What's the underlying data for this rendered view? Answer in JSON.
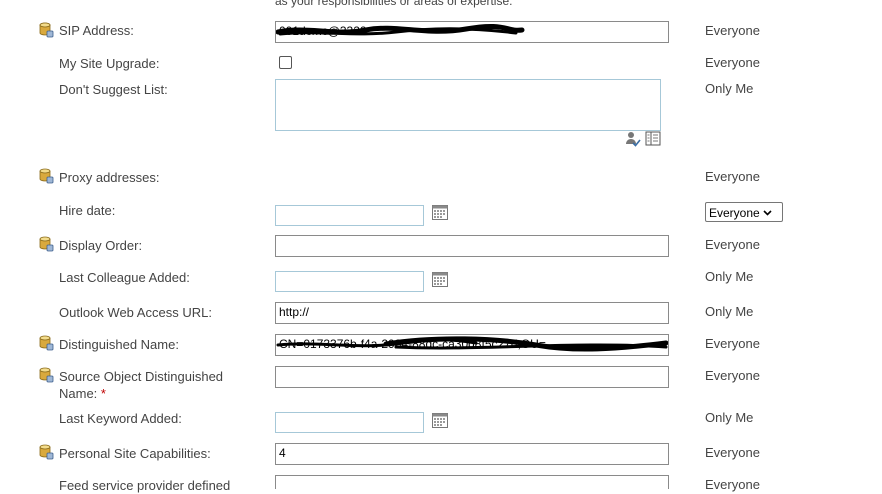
{
  "intro_text": "as your responsibilities or areas of expertise.",
  "fields": {
    "sip_address": {
      "label": "SIP Address:",
      "value": "001dcmc@3322...",
      "privacy": "Everyone"
    },
    "my_site_upgrade": {
      "label": "My Site Upgrade:",
      "checked": false,
      "privacy": "Everyone"
    },
    "dont_suggest_list": {
      "label": "Don't Suggest List:",
      "value": "",
      "privacy": "Only Me"
    },
    "proxy_addresses": {
      "label": "Proxy addresses:",
      "privacy": "Everyone"
    },
    "hire_date": {
      "label": "Hire date:",
      "value": "",
      "privacy_select": "Everyone"
    },
    "display_order": {
      "label": "Display Order:",
      "value": "",
      "privacy": "Everyone"
    },
    "last_colleague_added": {
      "label": "Last Colleague Added:",
      "value": "",
      "privacy": "Only Me"
    },
    "owa_url": {
      "label": "Outlook Web Access URL:",
      "value": "http://",
      "privacy": "Only Me"
    },
    "distinguished_name": {
      "label": "Distinguished Name:",
      "value": "CN=0173376b-f4a-2934-88dc-ca30d8f5c27d,OU=...",
      "privacy": "Everyone"
    },
    "source_object_dn": {
      "label": "Source Object Distinguished Name:",
      "required_mark": "*",
      "value": "",
      "privacy": "Everyone"
    },
    "last_keyword_added": {
      "label": "Last Keyword Added:",
      "value": "",
      "privacy": "Only Me"
    },
    "personal_site_capabilities": {
      "label": "Personal Site Capabilities:",
      "value": "4",
      "privacy": "Everyone"
    },
    "feed_service_provider": {
      "label": "Feed service provider defined",
      "value": "",
      "privacy": "Everyone"
    }
  },
  "icons": {
    "property": "database-icon",
    "calendar": "calendar-icon",
    "check_names": "check-names-icon",
    "browse": "address-book-icon"
  }
}
